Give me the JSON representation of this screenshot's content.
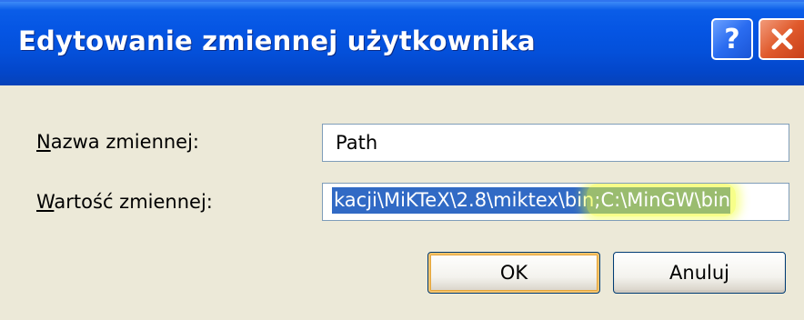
{
  "window": {
    "title": "Edytowanie zmiennej użytkownika",
    "help_label": "?",
    "colors": {
      "titlebar": "#0555e3",
      "face": "#ece9d8",
      "selection": "#316ac5",
      "highlight": "#f0ff28",
      "close": "#e05a2c"
    }
  },
  "form": {
    "name_label_accel": "N",
    "name_label_rest": "azwa zmiennej:",
    "name_value": "Path",
    "value_label_accel": "W",
    "value_label_rest": "artość zmiennej:",
    "value_text_selected": "kacji\\MiKTeX\\2.8\\miktex\\bin",
    "value_text_highlighted": ";C:\\MinGW\\bin"
  },
  "buttons": {
    "ok_label": "OK",
    "cancel_label": "Anuluj"
  }
}
